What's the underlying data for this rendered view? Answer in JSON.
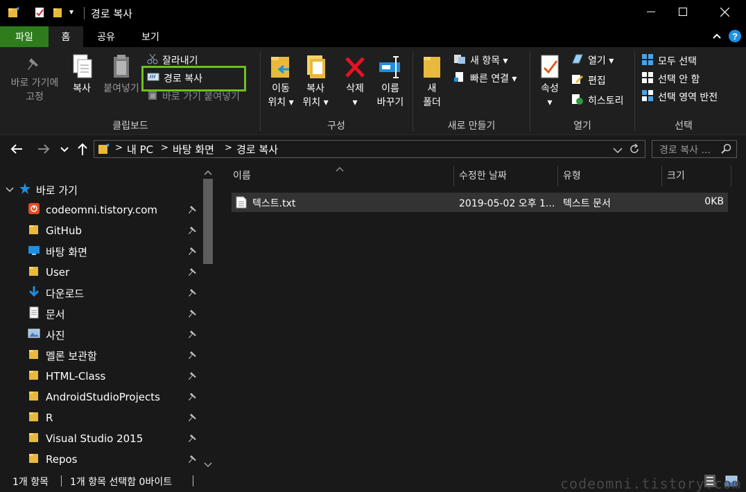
{
  "window": {
    "title": "경로 복사",
    "quick_access_dropdown": "▾"
  },
  "tabs": [
    {
      "label": "파일"
    },
    {
      "label": "홈"
    },
    {
      "label": "공유"
    },
    {
      "label": "보기"
    }
  ],
  "ribbon": {
    "clipboard": {
      "group_label": "클립보드",
      "pin_quick_access": [
        "바로 가기에",
        "고정"
      ],
      "copy": "복사",
      "paste": "붙여넣기",
      "cut": "잘라내기",
      "copy_path": "경로 복사",
      "paste_shortcut": "바로 가기 붙여넣기"
    },
    "organize": {
      "group_label": "구성",
      "move_to": [
        "이동",
        "위치 ▾"
      ],
      "copy_to": [
        "복사",
        "위치 ▾"
      ],
      "delete": [
        "삭제",
        "▾"
      ],
      "rename": [
        "이름",
        "바꾸기"
      ]
    },
    "new": {
      "group_label": "새로 만들기",
      "new_folder": [
        "새",
        "폴더"
      ],
      "new_item": "새 항목 ▾",
      "easy_access": "빠른 연결 ▾"
    },
    "open": {
      "group_label": "열기",
      "properties": [
        "속성",
        "▾"
      ],
      "open": "열기 ▾",
      "edit": "편집",
      "history": "히스토리"
    },
    "select": {
      "group_label": "선택",
      "select_all": "모두 선택",
      "select_none": "선택 안 함",
      "invert": "선택 영역 반전"
    }
  },
  "address": {
    "segments": [
      "내 PC",
      "바탕 화면",
      "경로 복사"
    ],
    "separator": ">",
    "search_placeholder": "경로 복사 ..."
  },
  "nav_pane": {
    "quick_access_label": "바로 가기",
    "items": [
      {
        "label": "codeomni.tistory.com",
        "icon": "site-icon"
      },
      {
        "label": "GitHub",
        "icon": "folder-icon"
      },
      {
        "label": "바탕 화면",
        "icon": "desktop-icon"
      },
      {
        "label": "User",
        "icon": "folder-icon"
      },
      {
        "label": "다운로드",
        "icon": "download-icon"
      },
      {
        "label": "문서",
        "icon": "document-icon"
      },
      {
        "label": "사진",
        "icon": "pictures-icon"
      },
      {
        "label": "멜론 보관함",
        "icon": "folder-icon"
      },
      {
        "label": "HTML-Class",
        "icon": "folder-icon"
      },
      {
        "label": "AndroidStudioProjects",
        "icon": "folder-icon"
      },
      {
        "label": "R",
        "icon": "folder-icon"
      },
      {
        "label": "Visual Studio 2015",
        "icon": "folder-icon"
      },
      {
        "label": "Repos",
        "icon": "folder-icon"
      }
    ]
  },
  "file_list": {
    "columns": [
      "이름",
      "수정한 날짜",
      "유형",
      "크기"
    ],
    "rows": [
      {
        "name": "텍스트.txt",
        "modified": "2019-05-02 오후 1...",
        "type": "텍스트 문서",
        "size": "0KB"
      }
    ]
  },
  "status_bar": {
    "item_count": "1개 항목",
    "selection": "1개 항목 선택함 0바이트"
  },
  "watermark": "codeomni.tistory.com",
  "colors": {
    "file_tab": "#2d7d1d",
    "highlight": "#6cc11c",
    "accent_blue": "#1e8fe1"
  }
}
